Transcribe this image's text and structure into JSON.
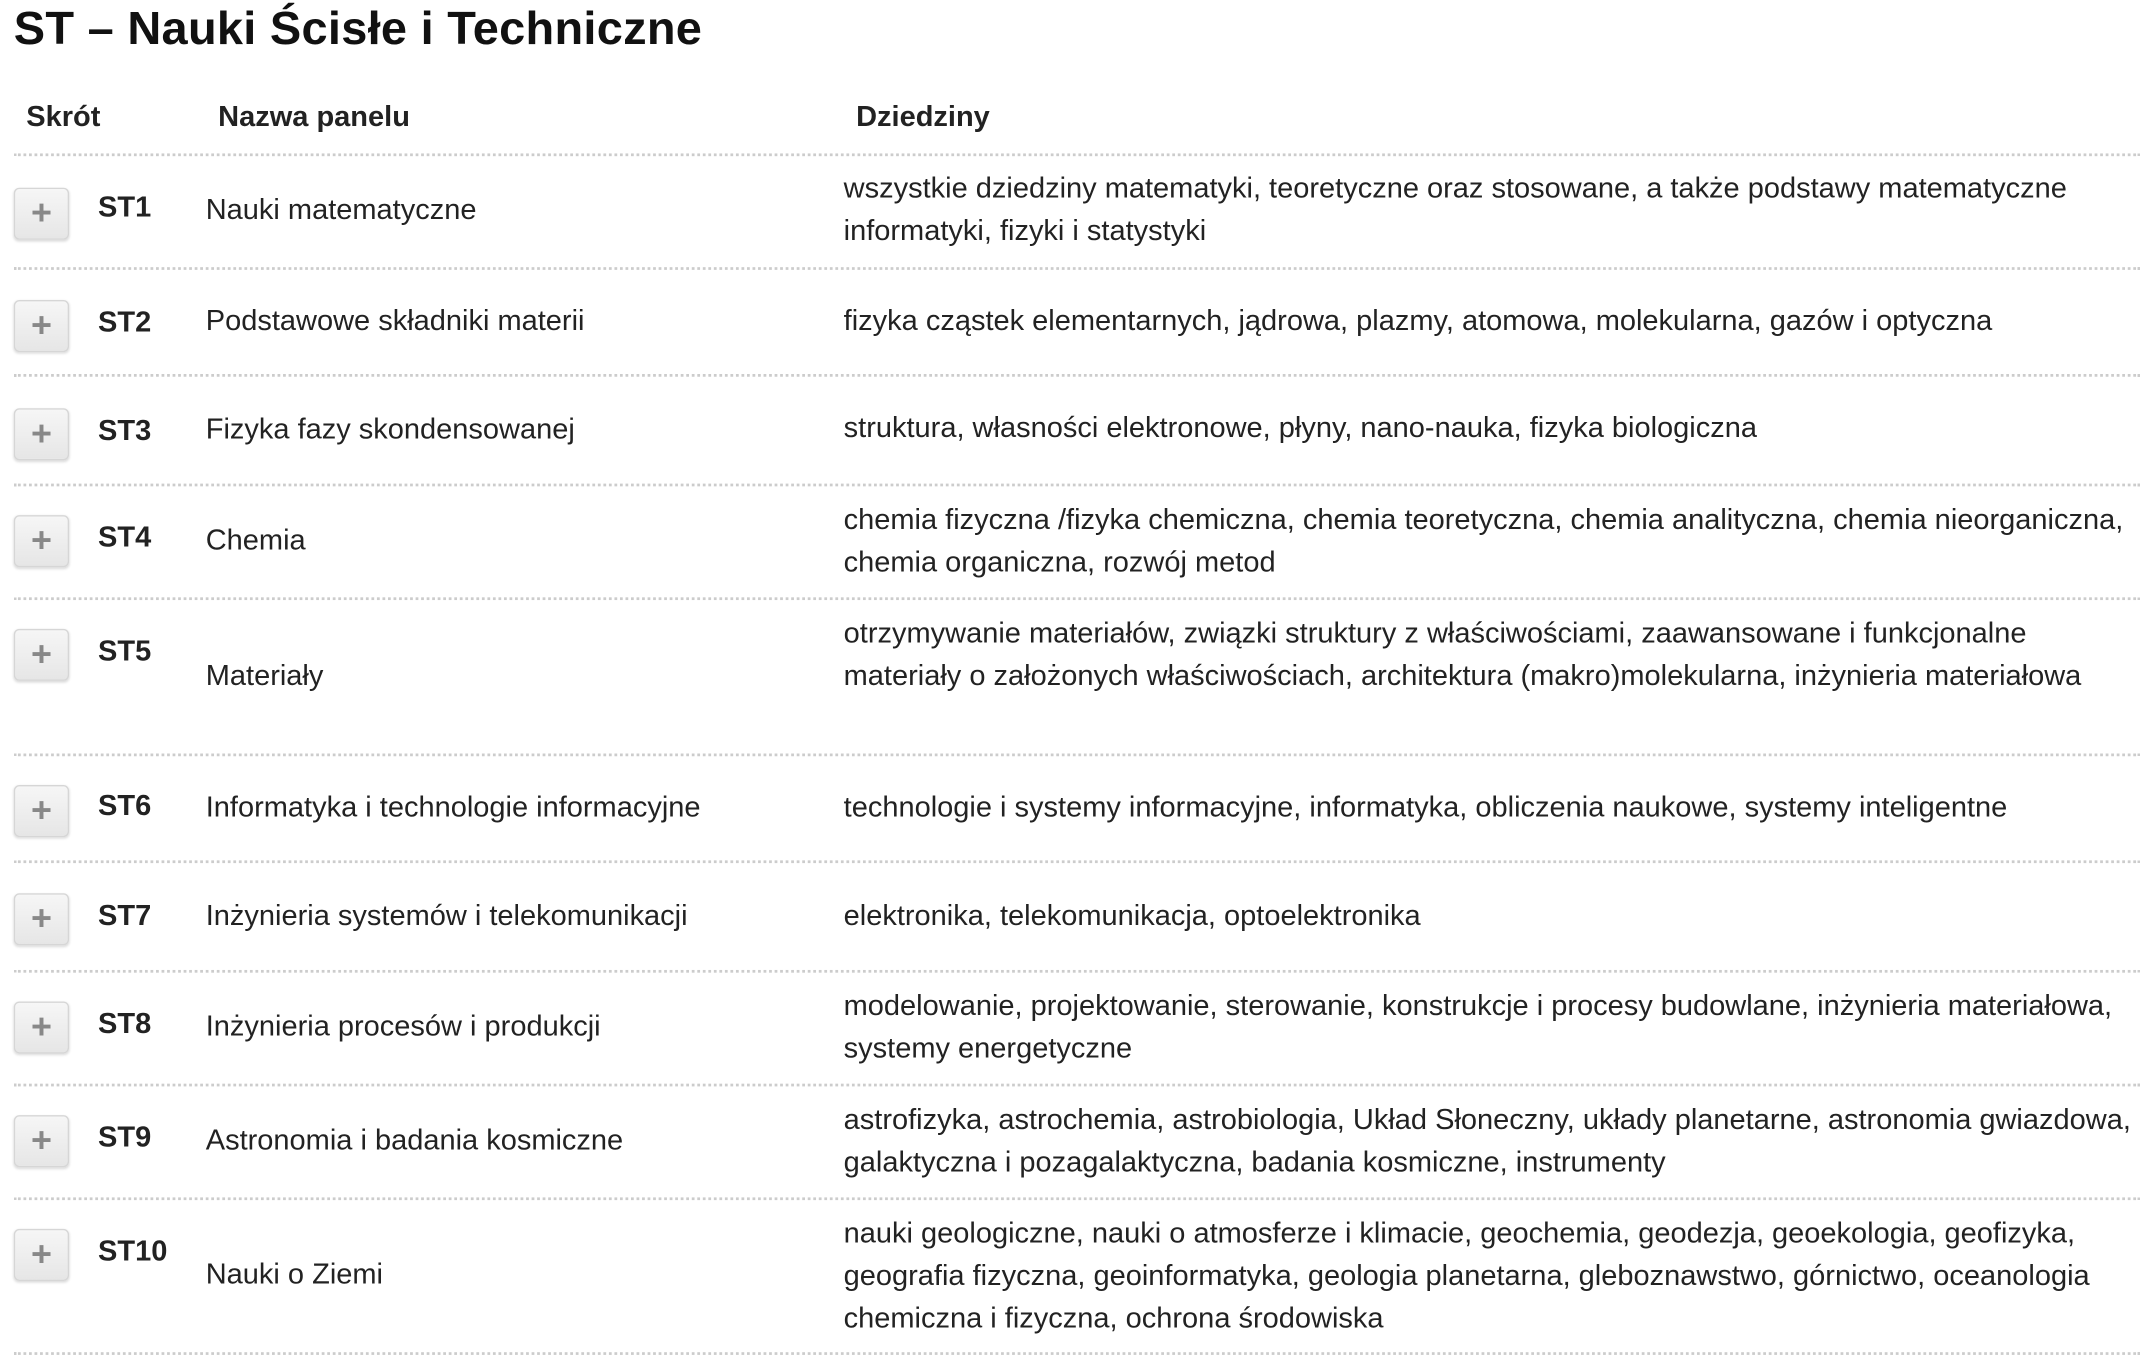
{
  "title": "ST – Nauki Ścisłe i Techniczne",
  "columns": {
    "code": "Skrót",
    "name": "Nazwa panelu",
    "fields": "Dziedziny"
  },
  "rows": [
    {
      "code": "ST1",
      "name": "Nauki matematyczne",
      "fields": "wszystkie dziedziny matematyki, teoretyczne oraz stosowane, a także podstawy matematyczne informatyki, fizyki i statystyki"
    },
    {
      "code": "ST2",
      "name": "Podstawowe składniki materii",
      "fields": "fizyka cząstek elementarnych, jądrowa, plazmy, atomowa, molekularna, gazów i optyczna"
    },
    {
      "code": "ST3",
      "name": "Fizyka fazy skondensowanej",
      "fields": "struktura, własności elektronowe, płyny, nano-nauka, fizyka biologiczna"
    },
    {
      "code": "ST4",
      "name": "Chemia",
      "fields": "chemia fizyczna /fizyka chemiczna, chemia teoretyczna, chemia analityczna, chemia nieorganiczna, chemia organiczna, rozwój metod"
    },
    {
      "code": "ST5",
      "name": "Materiały",
      "fields": "otrzymywanie materiałów, związki struktury z właściwościami, zaawansowane i funkcjonalne materiały o założonych właściwościach, architektura (makro)molekularna, inżynieria materiałowa"
    },
    {
      "code": "ST6",
      "name": "Informatyka i technologie informacyjne",
      "fields": "technologie i systemy informacyjne, informatyka, obliczenia naukowe, systemy inteligentne"
    },
    {
      "code": "ST7",
      "name": "Inżynieria systemów i telekomunikacji",
      "fields": "elektronika, telekomunikacja, optoelektronika"
    },
    {
      "code": "ST8",
      "name": "Inżynieria procesów i produkcji",
      "fields": "modelowanie, projektowanie, sterowanie, konstrukcje i procesy budowlane, inżynieria materiałowa, systemy energetyczne"
    },
    {
      "code": "ST9",
      "name": "Astronomia i badania kosmiczne",
      "fields": "astrofizyka, astrochemia, astrobiologia, Układ Słoneczny, układy planetarne, astronomia gwiazdowa, galaktyczna i pozagalaktyczna, badania kosmiczne, instrumenty"
    },
    {
      "code": "ST10",
      "name": "Nauki o Ziemi",
      "fields": "nauki geologiczne, nauki o atmosferze i klimacie, geochemia, geodezja, geoekologia, geofizyka, geografia fizyczna, geoinformatyka, geologia planetarna, gleboznawstwo, górnictwo, oceanologia chemiczna i fizyczna, ochrona środowiska"
    }
  ]
}
